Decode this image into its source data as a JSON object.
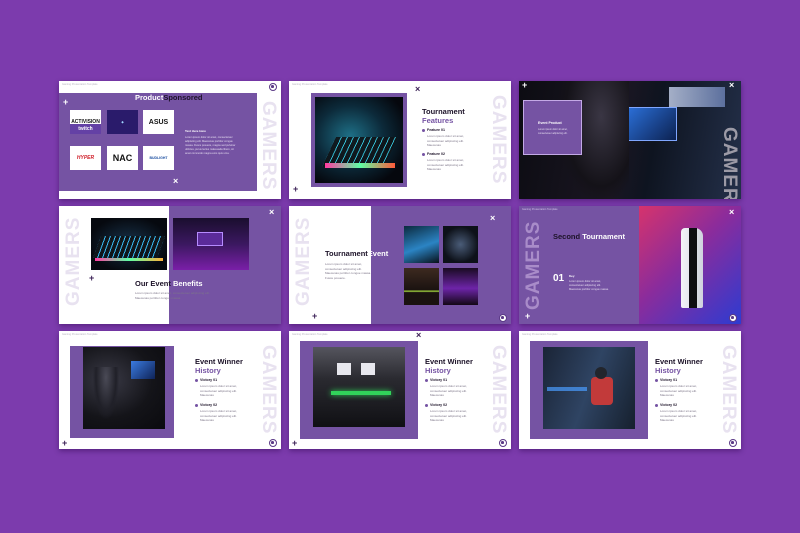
{
  "brand": {
    "word": "GAMERS"
  },
  "colors": {
    "background": "#7c3bad",
    "accent": "#7553a3",
    "dark": "#1d1329"
  },
  "slide1": {
    "title_a": "Product",
    "title_b": "Sponsored",
    "logos": [
      "ACTIVISION",
      "twitch",
      "ASUS",
      "HYPER",
      "NAC",
      "BUDLIGHT"
    ],
    "brand_text": "Text Here Here",
    "para": "Lorem ipsum dolor sit amet, consectetuer adipiscing elit. Maecenas porttitor congue massa. Fusce posuere, magna sed pulvinar ultricies, purus lectus malesuada libero, sit amet commodo magna eros quis urna."
  },
  "slide2": {
    "title_a": "Tournament",
    "title_b": "Features",
    "features": [
      {
        "label": "Feature 01",
        "text": "Lorem ipsum dolor sit amet, consectetuer adipiscing elit. Maecenas"
      },
      {
        "label": "Feature 02",
        "text": "Lorem ipsum dolor sit amet, consectetuer adipiscing elit. Maecenas"
      }
    ]
  },
  "slide3": {
    "box_title": "Event Product",
    "box_text": "Lorem ipsum dolor sit amet, consectetuer adipiscing elit."
  },
  "slide4": {
    "title_a": "Our Event",
    "title_b": "Benefits",
    "para": "Lorem ipsum dolor sit amet, consectetuer adipiscing elit. Maecenas porttitor congue massa."
  },
  "slide5": {
    "title_a": "Tournament",
    "title_b": "Event",
    "para": "Lorem ipsum dolor sit amet, consectetuer adipiscing elit. Maecenas porttitor congue massa. Fusce posuere."
  },
  "slide6": {
    "title_a": "Second",
    "title_b": "Tournament",
    "num": "01",
    "label": "Key",
    "para": "Lorem ipsum dolor sit amet, consectetuer adipiscing elit. Maecenas porttitor congue massa."
  },
  "winner": {
    "title_a": "Event Winner",
    "title_b": "History",
    "items": [
      {
        "label": "Victory 01",
        "text": "Lorem ipsum dolor sit amet, consectetuer adipiscing elit. Maecenas"
      },
      {
        "label": "Victory 02",
        "text": "Lorem ipsum dolor sit amet, consectetuer adipiscing elit. Maecenas"
      }
    ]
  },
  "header_tiny": "Gaming Presentation Template"
}
